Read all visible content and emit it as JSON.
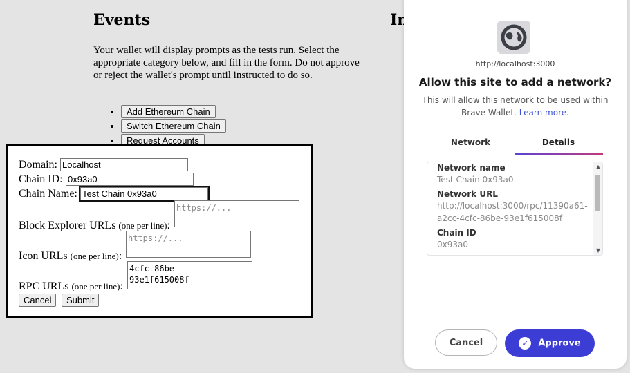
{
  "page": {
    "title": "Events",
    "second_title_fragment": "In",
    "intro": "Your wallet will display prompts as the tests run. Select the appropriate category below, and fill in the form. Do not approve or reject the wallet's prompt until instructed to do so.",
    "actions": [
      "Add Ethereum Chain",
      "Switch Ethereum Chain",
      "Request Accounts"
    ]
  },
  "form": {
    "domain_label": "Domain:",
    "domain_value": "Localhost",
    "chain_id_label": "Chain ID:",
    "chain_id_value": "0x93a0",
    "chain_name_label": "Chain Name:",
    "chain_name_value": "Test Chain 0x93a0",
    "explorer_label": "Block Explorer URLs",
    "explorer_hint": "(one per line)",
    "explorer_placeholder": "https://...",
    "icon_label": "Icon URLs",
    "icon_hint": "(one per line)",
    "icon_placeholder": "https://...",
    "rpc_label": "RPC URLs",
    "rpc_hint": "(one per line)",
    "rpc_value": "4cfc-86be-\n93e1f615008f",
    "colon": ":",
    "cancel": "Cancel",
    "submit": "Submit"
  },
  "wallet": {
    "site_url": "http://localhost:3000",
    "title": "Allow this site to add a network?",
    "description": "This will allow this network to be used within Brave Wallet.",
    "learn_more": "Learn more.",
    "tabs": [
      "Network",
      "Details"
    ],
    "active_tab": "Details",
    "details": [
      {
        "label": "Network name",
        "value": "Test Chain 0x93a0"
      },
      {
        "label": "Network URL",
        "value": "http://localhost:3000/rpc/11390a61-a2cc-4cfc-86be-93e1f615008f"
      },
      {
        "label": "Chain ID",
        "value": "0x93a0"
      }
    ],
    "cancel": "Cancel",
    "approve": "Approve",
    "accent": "#3b3dd4"
  }
}
